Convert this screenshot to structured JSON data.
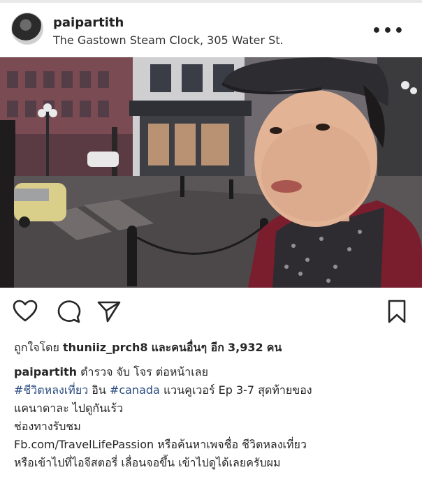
{
  "post": {
    "username": "paipartith",
    "location": "The Gastown Steam Clock, 305 Water St.",
    "more_icon": "more-horizontal-icon"
  },
  "icons": {
    "like": "heart-icon",
    "comment": "comment-icon",
    "share": "send-icon",
    "save": "bookmark-icon"
  },
  "likes": {
    "prefix": "ถูกใจโดย",
    "user": "thuniiz_prch8",
    "middle": "และคนอื่นๆ อีก",
    "count": "3,932",
    "suffix": "คน"
  },
  "caption": {
    "username": "paipartith",
    "line1_text": "ตำรวจ จับ โจร ต่อหน้าเลย",
    "hashtag1": "#ชีวิตหลงเที่ยว",
    "line2_mid": "อิน",
    "hashtag2": "#canada",
    "line2_rest": "แวนคูเวอร์ Ep 3-7 สุดท้ายของ",
    "line3": "แคนาดาละ ไปดูกันเร้ว",
    "line4": "ช่องทางรับชม",
    "line5": "Fb.com/TravelLifePassion หรือค้นหาเพจชื่อ ชีวิตหลงเที่ยว",
    "line6": "หรือเข้าไปที่ไอจีสตอรี่ เลื่อนจอขึ้น เข้าไปดูได้เลยครับผม"
  },
  "colors": {
    "text": "#262626",
    "hashtag": "#2b4c7e"
  }
}
